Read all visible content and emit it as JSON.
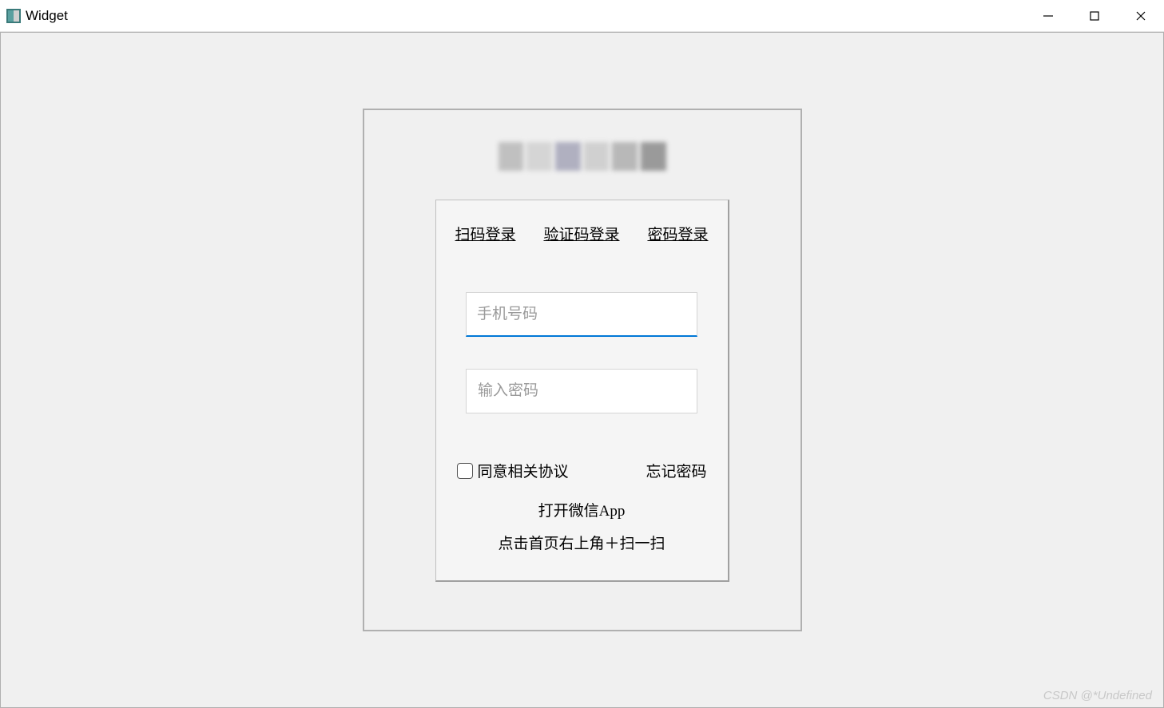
{
  "window": {
    "title": "Widget"
  },
  "login": {
    "tabs": {
      "qr": "扫码登录",
      "sms": "验证码登录",
      "password": "密码登录"
    },
    "phone": {
      "placeholder": "手机号码",
      "value": ""
    },
    "password": {
      "placeholder": "输入密码",
      "value": ""
    },
    "agree_label": "同意相关协议",
    "forgot_label": "忘记密码",
    "hint1": "打开微信App",
    "hint2": "点击首页右上角＋扫一扫"
  },
  "watermark": "CSDN @*Undefined"
}
